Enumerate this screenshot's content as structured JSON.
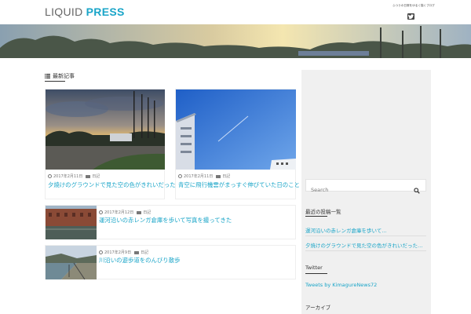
{
  "header": {
    "logo_part1": "LIQUID ",
    "logo_part2": "PRESS",
    "tagline": "ふつうの日常をゆるく描くブログ"
  },
  "main": {
    "section_title": "最新記事",
    "featured": [
      {
        "date": "2017年2月11日",
        "category": "日記",
        "title": "夕焼けのグラウンドで見た空の色がきれいだった"
      },
      {
        "date": "2017年2月11日",
        "category": "日記",
        "title": "青空に飛行機雲がまっすぐ伸びていた日のこと"
      }
    ],
    "list": [
      {
        "date": "2017年2月12日",
        "category": "日記",
        "title": "運河沿いの赤レンガ倉庫を歩いて写真を撮ってきた"
      },
      {
        "date": "2017年2月9日",
        "category": "日記",
        "title": "川沿いの遊歩道をのんびり散歩"
      }
    ]
  },
  "sidebar": {
    "search_placeholder": "Search",
    "recent_heading": "最近の投稿一覧",
    "recent_posts": [
      "運河沿いの赤レンガ倉庫を歩いて…",
      "夕焼けのグラウンドで見た空の色がきれいだった…"
    ],
    "twitter_heading": "Twitter",
    "twitter_link": "Tweets by KimagureNews72",
    "archive_heading": "アーカイブ"
  },
  "colors": {
    "accent": "#1aa5c8",
    "sidebar_bg": "#f0f0f0"
  }
}
